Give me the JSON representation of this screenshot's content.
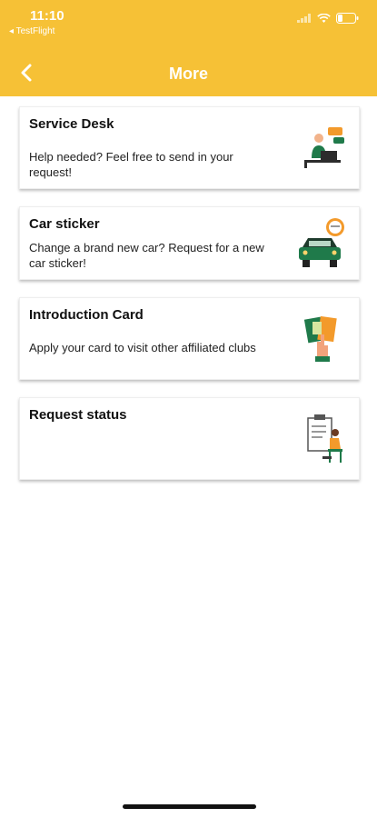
{
  "status_bar": {
    "time": "11:10",
    "back_app": "◂ TestFlight"
  },
  "nav": {
    "title": "More"
  },
  "cards": [
    {
      "title": "Service Desk",
      "description": "Help needed? Feel free to send in your request!",
      "icon": "service-desk-illustration"
    },
    {
      "title": "Car sticker",
      "description": "Change a brand new car? Request for a new car sticker!",
      "icon": "car-sticker-illustration"
    },
    {
      "title": "Introduction Card",
      "description": "Apply your card to visit other affiliated clubs",
      "icon": "introduction-card-illustration"
    },
    {
      "title": "Request status",
      "description": "",
      "icon": "request-status-illustration"
    }
  ],
  "colors": {
    "header": "#F6C136",
    "accent_green": "#1F7A4A",
    "accent_orange": "#F39A2B"
  }
}
